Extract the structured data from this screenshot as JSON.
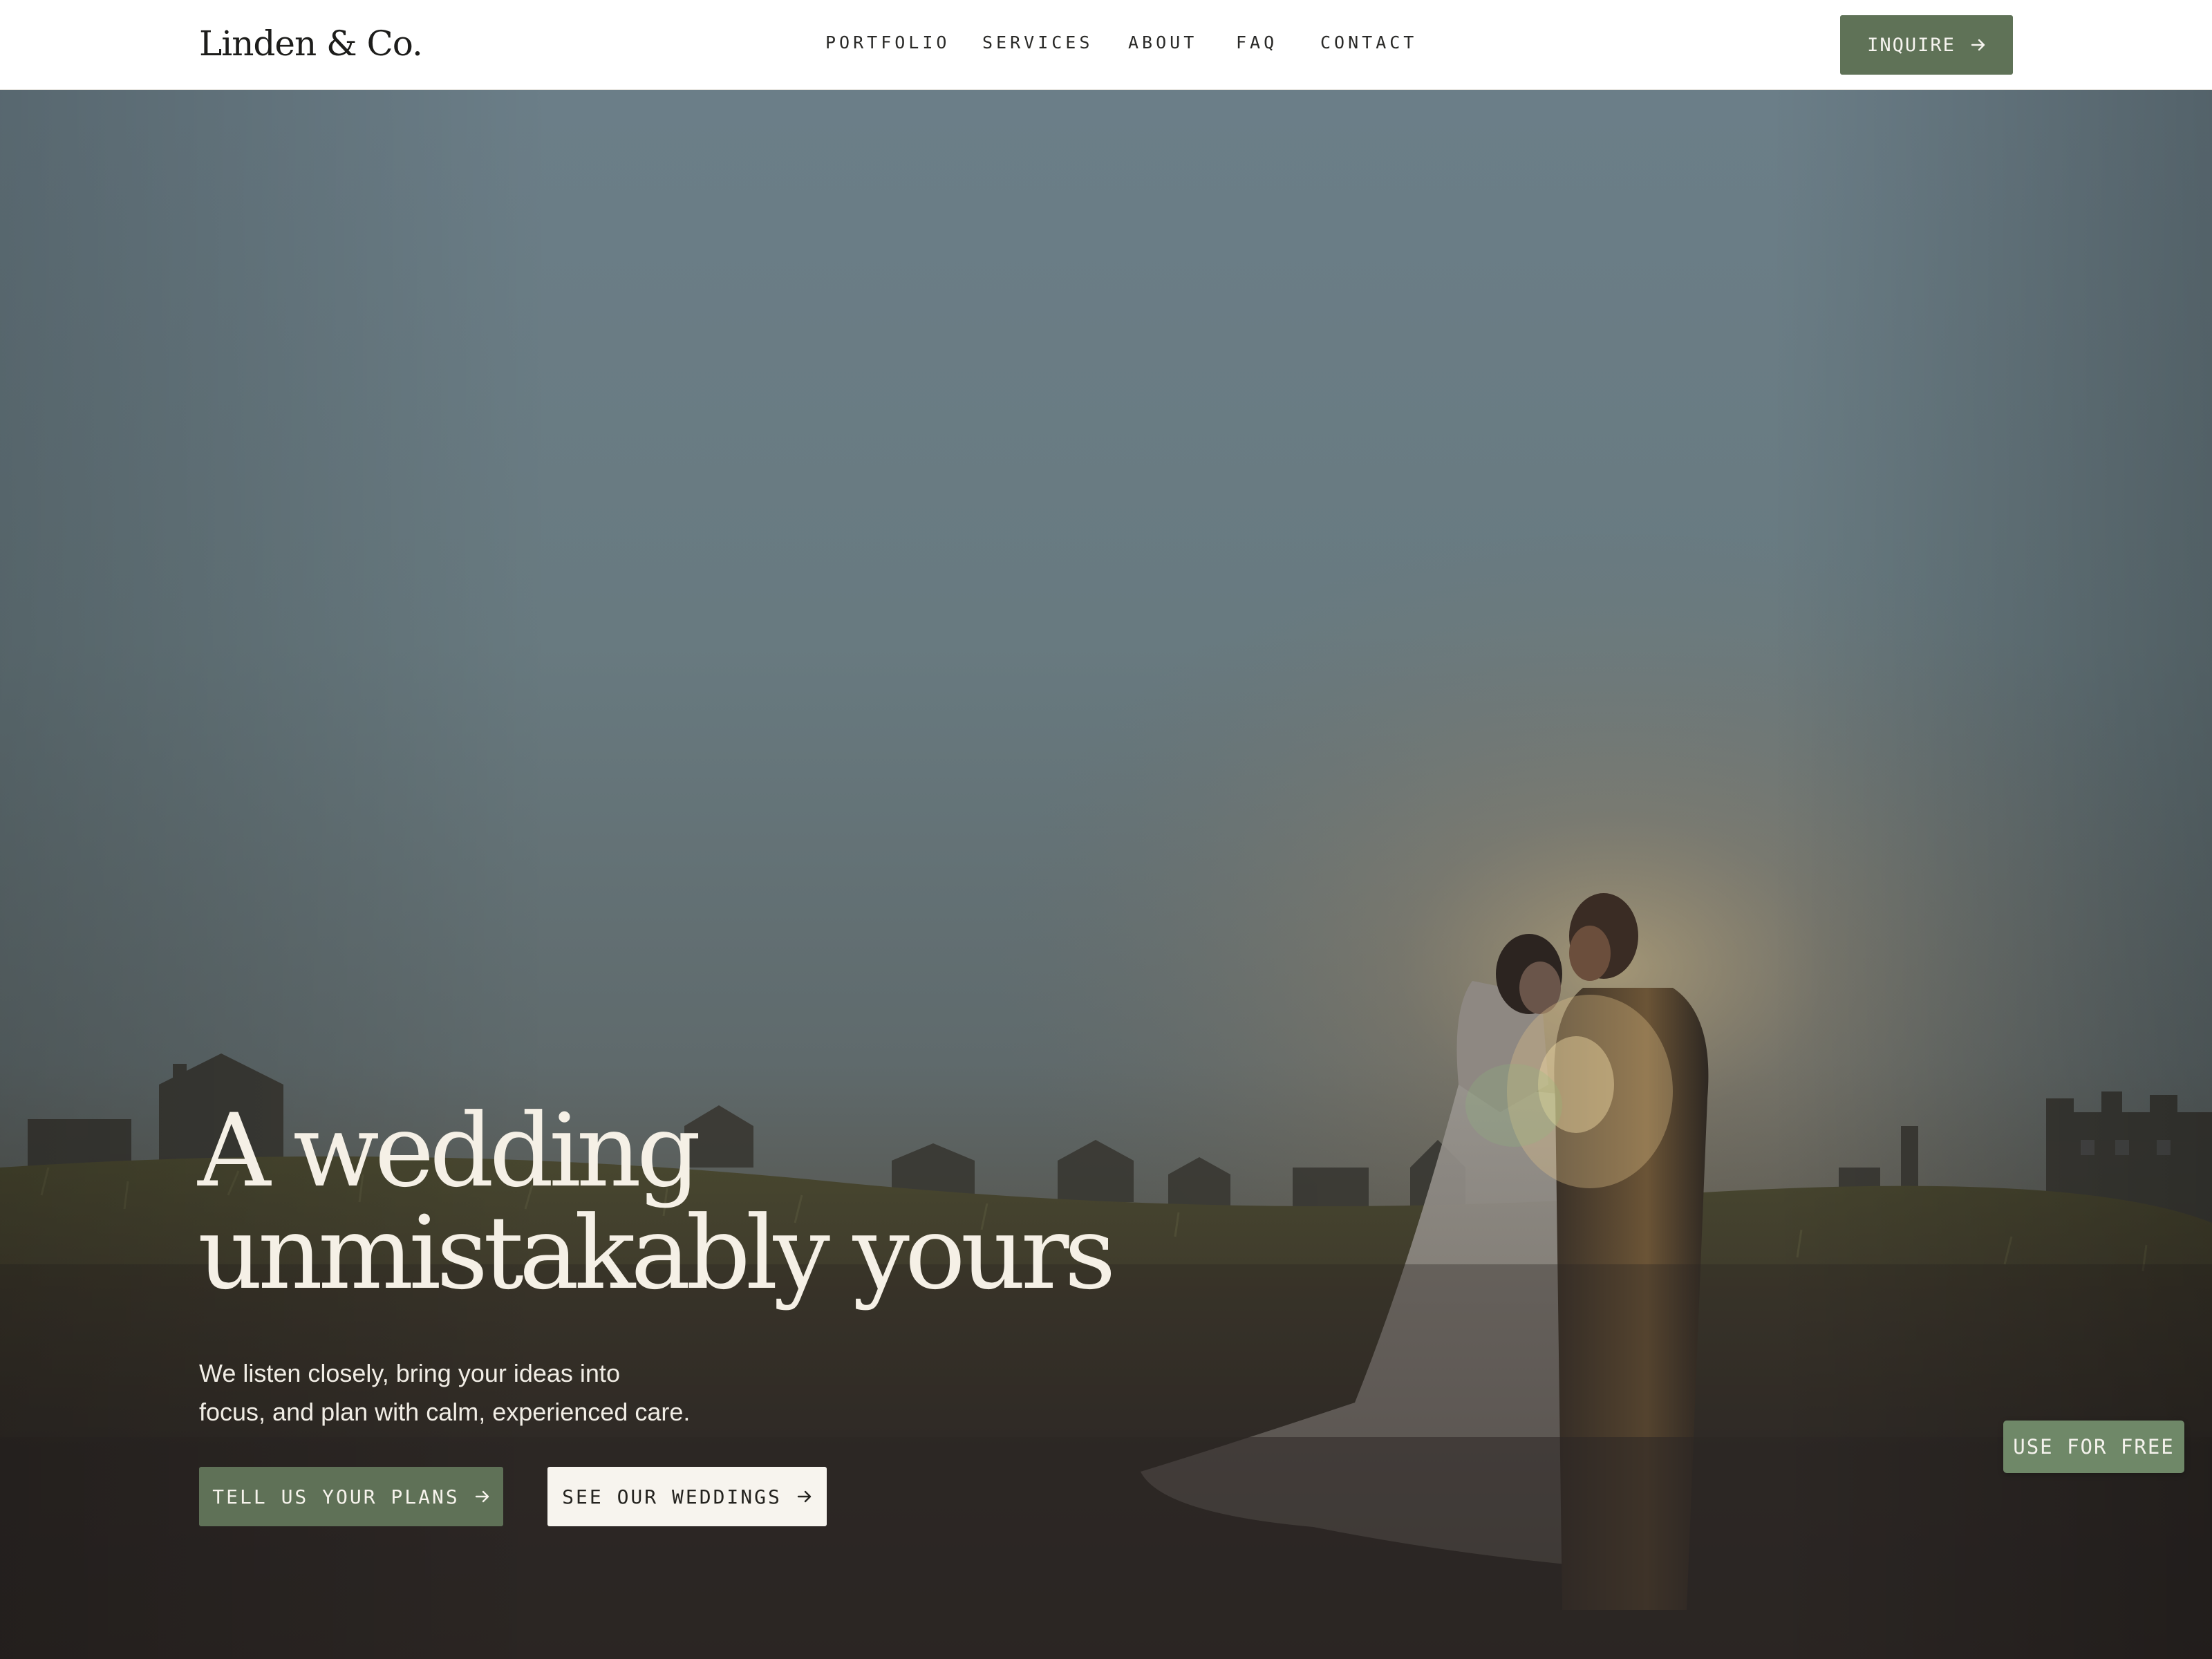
{
  "header": {
    "logo": "Linden & Co.",
    "nav": [
      {
        "label": "PORTFOLIO"
      },
      {
        "label": "SERVICES"
      },
      {
        "label": "ABOUT"
      },
      {
        "label": "FAQ"
      },
      {
        "label": "CONTACT"
      }
    ],
    "inquire_label": "INQUIRE",
    "inquire_icon": "arrow-right-icon"
  },
  "hero": {
    "title_line1": "A wedding",
    "title_line2": "unmistakably yours",
    "subtitle_line1": "We listen closely, bring your ideas into",
    "subtitle_line2": "focus, and plan with calm, experienced care.",
    "primary_cta": "TELL US YOUR PLANS",
    "secondary_cta": "SEE OUR WEDDINGS",
    "cta_icon": "arrow-right-icon",
    "photo_subject": "couple embracing in a grassy field at sunset"
  },
  "badge": {
    "label": "USE FOR FREE"
  },
  "colors": {
    "accent_green": "#5f7157",
    "badge_green": "#6f8868",
    "cream": "#f5f0e6",
    "header_bg": "#ffffff"
  }
}
